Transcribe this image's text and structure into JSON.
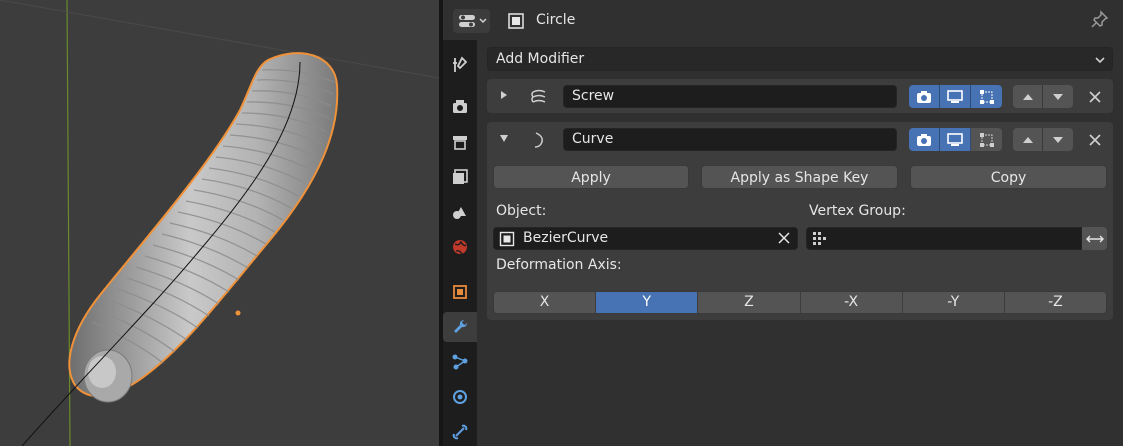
{
  "header": {
    "object_name": "Circle",
    "editor_type_icon": "properties-editor-icon",
    "pin_icon": "pin-icon"
  },
  "add_modifier": {
    "label": "Add Modifier"
  },
  "tabs": [
    {
      "name": "tool-tab",
      "icon": "tool-icon"
    },
    {
      "name": "render-tab",
      "icon": "render-icon"
    },
    {
      "name": "output-tab",
      "icon": "output-icon"
    },
    {
      "name": "view-layer-tab",
      "icon": "view-layer-icon"
    },
    {
      "name": "scene-tab",
      "icon": "scene-icon"
    },
    {
      "name": "world-tab",
      "icon": "world-icon"
    },
    {
      "name": "object-tab",
      "icon": "object-icon"
    },
    {
      "name": "modifier-tab",
      "icon": "wrench-icon",
      "active": true
    },
    {
      "name": "particles-tab",
      "icon": "particles-icon"
    },
    {
      "name": "physics-tab",
      "icon": "physics-icon"
    },
    {
      "name": "constraints-tab",
      "icon": "constraints-icon"
    }
  ],
  "modifiers": [
    {
      "name": "Screw",
      "expanded": false,
      "icon": "screw-modifier-icon",
      "show_render": true,
      "show_viewport": true,
      "show_editmode": true
    },
    {
      "name": "Curve",
      "expanded": true,
      "icon": "curve-modifier-icon",
      "show_render": true,
      "show_viewport": true,
      "show_editmode": false,
      "buttons": {
        "apply": "Apply",
        "apply_shape_key": "Apply as Shape Key",
        "copy": "Copy"
      },
      "object_label": "Object:",
      "object_value": "BezierCurve",
      "vertex_group_label": "Vertex Group:",
      "vertex_group_value": "",
      "deformation_axis_label": "Deformation Axis:",
      "axes": [
        "X",
        "Y",
        "Z",
        "-X",
        "-Y",
        "-Z"
      ],
      "selected_axis": "Y"
    }
  ],
  "colors": {
    "accent": "#4772b3",
    "selection_outline": "#f0923a",
    "viewport_bg": "#3d3d3d"
  }
}
